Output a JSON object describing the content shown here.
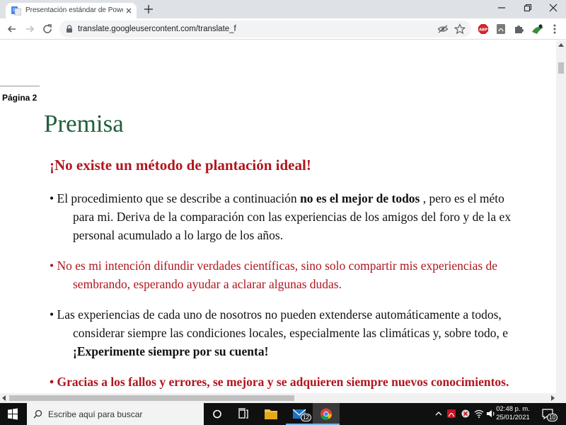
{
  "browser": {
    "tab_title": "Presentación estándar de PowerP",
    "url": "translate.googleusercontent.com/translate_f"
  },
  "page": {
    "page_label": "Página 2",
    "title": "Premisa",
    "subtitle": "¡No existe un método de plantación ideal!",
    "p1": {
      "l1a": "• El procedimiento que se describe a continuación ",
      "l1b": "no es el mejor de todos",
      "l1c": " , pero es el méto",
      "l2": "para mi. Deriva de la comparación con las experiencias de los amigos del foro y de la ex",
      "l3": "personal acumulado a lo largo de los años."
    },
    "p2": {
      "l1": "• No es mi intención difundir verdades científicas, sino solo compartir mis experiencias de",
      "l2": "sembrando, esperando ayudar a aclarar algunas dudas."
    },
    "p3": {
      "l1": "• Las experiencias de cada uno de nosotros no pueden extenderse automáticamente a todos,",
      "l2": "considerar siempre las condiciones locales, especialmente las climáticas y, sobre todo, e",
      "l3": "¡Experimente siempre por su cuenta!"
    },
    "p4": {
      "l1": "• Gracias a los fallos y errores, se mejora y se adquieren siempre nuevos conocimientos."
    }
  },
  "taskbar": {
    "search_placeholder": "Escribe aquí para buscar",
    "mail_badge": "12",
    "time": "02:48 p. m.",
    "date": "25/01/2021",
    "notification_count": "10"
  },
  "colors": {
    "title_green": "#1f5f3d",
    "accent_red": "#b0161e"
  }
}
